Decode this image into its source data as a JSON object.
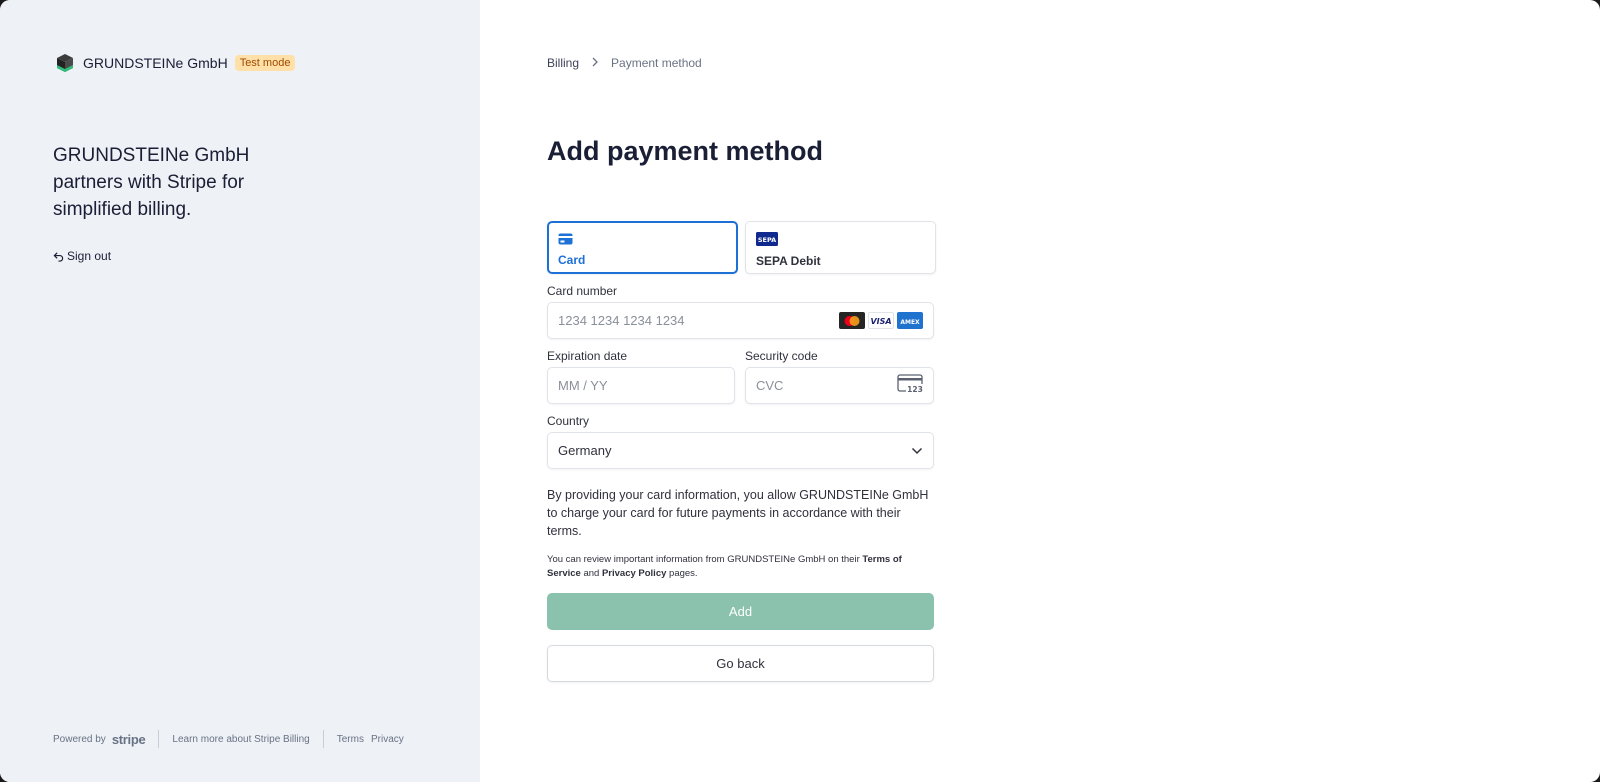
{
  "brand": {
    "name": "GRUNDSTEINe GmbH",
    "badge": "Test mode",
    "tagline": "GRUNDSTEINe GmbH partners with Stripe for simplified billing.",
    "sign_out": "Sign out"
  },
  "footer": {
    "powered_by": "Powered by",
    "stripe": "stripe",
    "learn_more": "Learn more about Stripe Billing",
    "terms": "Terms",
    "privacy": "Privacy"
  },
  "breadcrumb": {
    "items": [
      "Billing",
      "Payment method"
    ]
  },
  "page": {
    "title": "Add payment method"
  },
  "methods": [
    {
      "label": "Card",
      "icon": "card-icon",
      "selected": true
    },
    {
      "label": "SEPA Debit",
      "icon": "sepa-icon",
      "selected": false
    }
  ],
  "form": {
    "card_number_label": "Card number",
    "card_number_placeholder": "1234 1234 1234 1234",
    "card_brands": [
      "mastercard",
      "visa",
      "amex"
    ],
    "expiry_label": "Expiration date",
    "expiry_placeholder": "MM / YY",
    "cvc_label": "Security code",
    "cvc_placeholder": "CVC",
    "country_label": "Country",
    "country_value": "Germany"
  },
  "consent": "By providing your card information, you allow GRUNDSTEINe GmbH to charge your card for future payments in accordance with their terms.",
  "legal": {
    "prefix": "You can review important information from GRUNDSTEINe GmbH on their ",
    "tos": "Terms of Service",
    "and": " and ",
    "privacy": "Privacy Policy",
    "suffix": " pages."
  },
  "buttons": {
    "add": "Add",
    "back": "Go back"
  },
  "colors": {
    "accent": "#1d70d6",
    "add_button": "#8bc2ae",
    "badge_bg": "#ffe0a8"
  }
}
